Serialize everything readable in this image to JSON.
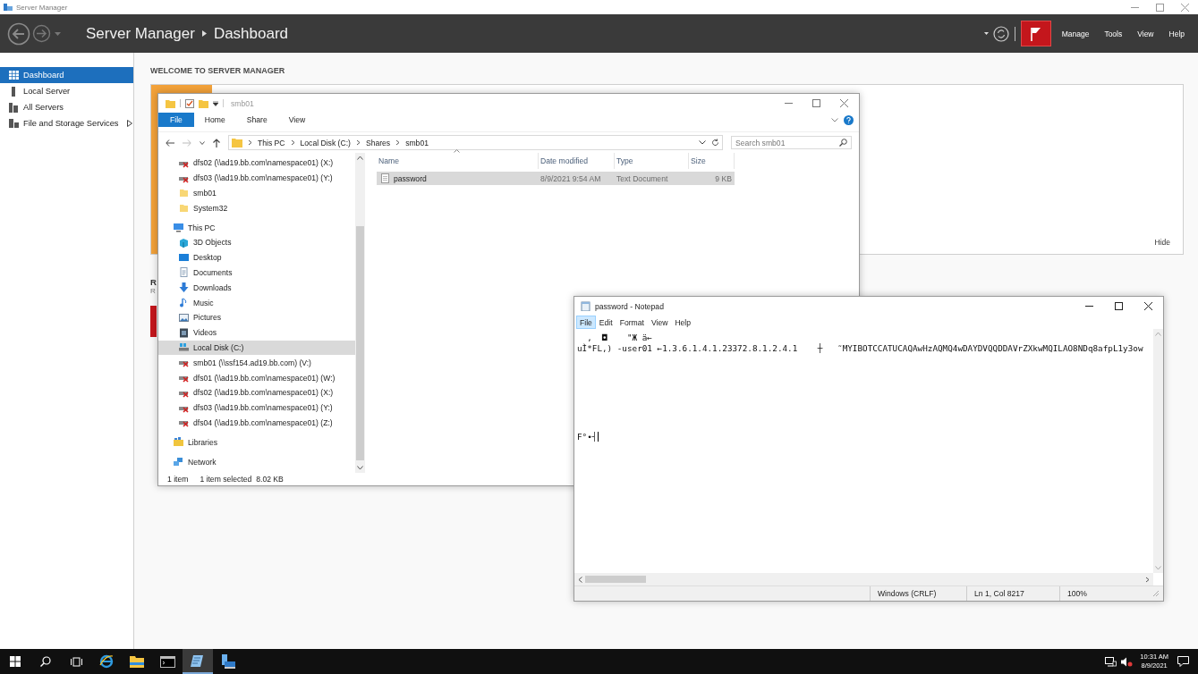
{
  "server_manager": {
    "window_title": "Server Manager",
    "breadcrumb": [
      "Server Manager",
      "Dashboard"
    ],
    "menu": [
      "Manage",
      "Tools",
      "View",
      "Help"
    ],
    "sidebar": [
      {
        "label": "Dashboard",
        "kind": "dashboard",
        "selected": true,
        "has_submenu": false
      },
      {
        "label": "Local Server",
        "kind": "server",
        "selected": false,
        "has_submenu": false
      },
      {
        "label": "All Servers",
        "kind": "servers",
        "selected": false,
        "has_submenu": false
      },
      {
        "label": "File and Storage Services",
        "kind": "storage",
        "selected": false,
        "has_submenu": true
      }
    ],
    "welcome": {
      "heading": "WELCOME TO SERVER MANAGER",
      "hide": "Hide"
    },
    "roles_heading": "R",
    "roles_subtitle": "R"
  },
  "explorer": {
    "title": "smb01",
    "ribbon_tabs": [
      {
        "label": "File",
        "selected": true
      },
      {
        "label": "Home",
        "selected": false
      },
      {
        "label": "Share",
        "selected": false
      },
      {
        "label": "View",
        "selected": false
      }
    ],
    "address": [
      "This PC",
      "Local Disk (C:)",
      "Shares",
      "smb01"
    ],
    "search": {
      "placeholder": "Search smb01"
    },
    "nav_tree_overflow": [
      {
        "label": "dfs02 (\\\\ad19.bb.com\\namespace01) (X:)",
        "kind": "network_drive",
        "selected": false
      },
      {
        "label": "dfs03 (\\\\ad19.bb.com\\namespace01) (Y:)",
        "kind": "network_drive",
        "selected": false
      },
      {
        "label": "smb01",
        "kind": "folder",
        "selected": false
      },
      {
        "label": "System32",
        "kind": "folder",
        "selected": false
      }
    ],
    "nav_tree": [
      {
        "label": "This PC",
        "kind": "pc",
        "selected": false,
        "children": [
          {
            "label": "3D Objects",
            "kind": "objects3d",
            "selected": false
          },
          {
            "label": "Desktop",
            "kind": "desktop",
            "selected": false
          },
          {
            "label": "Documents",
            "kind": "documents",
            "selected": false
          },
          {
            "label": "Downloads",
            "kind": "downloads",
            "selected": false
          },
          {
            "label": "Music",
            "kind": "music",
            "selected": false
          },
          {
            "label": "Pictures",
            "kind": "pictures",
            "selected": false
          },
          {
            "label": "Videos",
            "kind": "videos",
            "selected": false
          },
          {
            "label": "Local Disk (C:)",
            "kind": "disk",
            "selected": true
          },
          {
            "label": "smb01 (\\\\ssf154.ad19.bb.com) (V:)",
            "kind": "network_drive",
            "selected": false
          },
          {
            "label": "dfs01 (\\\\ad19.bb.com\\namespace01) (W:)",
            "kind": "network_drive",
            "selected": false
          },
          {
            "label": "dfs02 (\\\\ad19.bb.com\\namespace01) (X:)",
            "kind": "network_drive",
            "selected": false
          },
          {
            "label": "dfs03 (\\\\ad19.bb.com\\namespace01) (Y:)",
            "kind": "network_drive",
            "selected": false
          },
          {
            "label": "dfs04 (\\\\ad19.bb.com\\namespace01) (Z:)",
            "kind": "network_drive",
            "selected": false
          }
        ]
      },
      {
        "label": "Libraries",
        "kind": "libraries",
        "selected": false
      },
      {
        "label": "Network",
        "kind": "network",
        "selected": false
      }
    ],
    "columns": [
      "Name",
      "Date modified",
      "Type",
      "Size"
    ],
    "files": [
      {
        "name": "password",
        "date_modified": "8/9/2021 9:54 AM",
        "type": "Text Document",
        "size": "9 KB",
        "selected": true
      }
    ],
    "status": [
      "1 item",
      "1 item selected",
      "8.02 KB"
    ]
  },
  "notepad": {
    "title": "password - Notepad",
    "menu": [
      {
        "label": "File",
        "selected": true
      },
      {
        "label": "Edit",
        "selected": false
      },
      {
        "label": "Format",
        "selected": false
      },
      {
        "label": "View",
        "selected": false
      },
      {
        "label": "Help",
        "selected": false
      }
    ],
    "lines": [
      "  ,  ◘    \"Ж ä←",
      "uÌ*FL,) -user01 ←1.3.6.1.4.1.23372.8.1.2.4.1    ┼   ˜MYIBOTCCATUCAQAwHzAQMQ4wDAYDVQQDDAVrZXkwMQILAO8NDq8afpL1y3ow",
      "F°•┤"
    ],
    "status": [
      "Windows (CRLF)",
      "Ln 1, Col 8217",
      "100%"
    ]
  },
  "taskbar": {
    "apps": [
      {
        "kind": "browser",
        "active": false
      },
      {
        "kind": "explorer",
        "active": false
      },
      {
        "kind": "terminal",
        "active": false
      },
      {
        "kind": "notepad",
        "active": true
      },
      {
        "kind": "server_manager",
        "active": false
      }
    ],
    "time": "10:31 AM",
    "date": "8/9/2021"
  }
}
